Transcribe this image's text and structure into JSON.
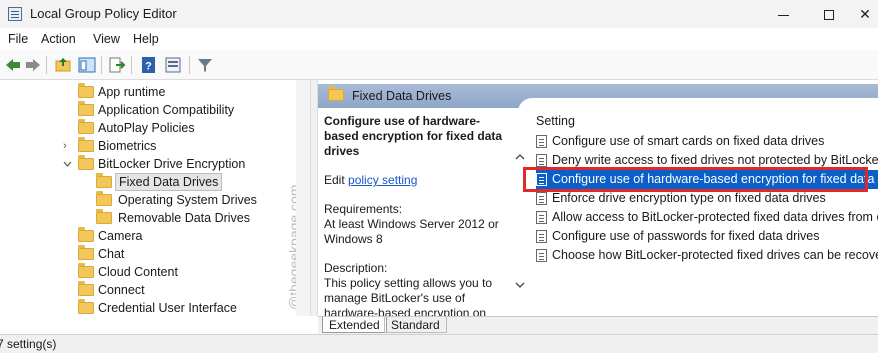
{
  "window": {
    "title": "Local Group Policy Editor",
    "controls": {
      "minimize": "minimize",
      "maximize": "maximize",
      "close": "✕"
    }
  },
  "menu": [
    "File",
    "Action",
    "View",
    "Help"
  ],
  "toolbar_icons": [
    "back-arrow-icon",
    "forward-arrow-icon",
    "up-folder-icon",
    "show-hide-tree-icon",
    "export-list-icon",
    "help-icon",
    "properties-icon",
    "filter-icon"
  ],
  "tree": {
    "items": [
      {
        "label": "App runtime",
        "indent": 1,
        "expand": ""
      },
      {
        "label": "Application Compatibility",
        "indent": 1,
        "expand": ""
      },
      {
        "label": "AutoPlay Policies",
        "indent": 1,
        "expand": ""
      },
      {
        "label": "Biometrics",
        "indent": 1,
        "expand": ">"
      },
      {
        "label": "BitLocker Drive Encryption",
        "indent": 1,
        "expand": "v"
      },
      {
        "label": "Fixed Data Drives",
        "indent": 2,
        "expand": "",
        "selected": true
      },
      {
        "label": "Operating System Drives",
        "indent": 2,
        "expand": ""
      },
      {
        "label": "Removable Data Drives",
        "indent": 2,
        "expand": ""
      },
      {
        "label": "Camera",
        "indent": 1,
        "expand": ""
      },
      {
        "label": "Chat",
        "indent": 1,
        "expand": ""
      },
      {
        "label": "Cloud Content",
        "indent": 1,
        "expand": ""
      },
      {
        "label": "Connect",
        "indent": 1,
        "expand": ""
      },
      {
        "label": "Credential User Interface",
        "indent": 1,
        "expand": ""
      }
    ]
  },
  "right": {
    "header": "Fixed Data Drives",
    "description": {
      "title": "Configure use of hardware-based encryption for fixed data drives",
      "edit_prefix": "Edit ",
      "edit_link": "policy setting",
      "requirements_label": "Requirements:",
      "requirements_text": "At least Windows Server 2012 or Windows 8",
      "description_label": "Description:",
      "description_text": "This policy setting allows you to manage BitLocker's use of hardware-based encryption on"
    },
    "column_header": "Setting",
    "settings": [
      "Configure use of smart cards on fixed data drives",
      "Deny write access to fixed drives not protected by BitLocker",
      "Configure use of hardware-based encryption for fixed data ...",
      "Enforce drive encryption type on fixed data drives",
      "Allow access to BitLocker-protected fixed data drives from e...",
      "Configure use of passwords for fixed data drives",
      "Choose how BitLocker-protected fixed drives can be recover..."
    ],
    "selected_index": 2,
    "tabs": [
      "Extended",
      "Standard"
    ]
  },
  "status": "7 setting(s)",
  "watermark": "@thegeekpage.com",
  "colors": {
    "selection": "#0a60c8",
    "highlight_border": "#e02a2a",
    "header_bg": "#9fb3d3"
  }
}
